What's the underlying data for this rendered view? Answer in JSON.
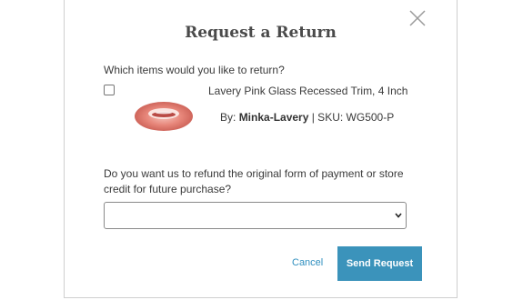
{
  "dialog": {
    "title": "Request a Return",
    "items_question": "Which items would you like to return?",
    "product": {
      "name": "Lavery Pink Glass Recessed Trim, 4 Inch",
      "by_label": "By:",
      "brand": "Minka-Lavery",
      "sku_text": "| SKU: WG500-P",
      "checked": false
    },
    "refund_question": "Do you want us to refund the original form of payment or store credit for future purchase?",
    "refund_select_value": "",
    "cancel_label": "Cancel",
    "send_label": "Send Request"
  },
  "colors": {
    "accent": "#3b93bb",
    "link": "#2f8fbf",
    "text": "#333333"
  },
  "icons": [
    "close-icon",
    "chevron-down-icon",
    "product-thumbnail"
  ]
}
